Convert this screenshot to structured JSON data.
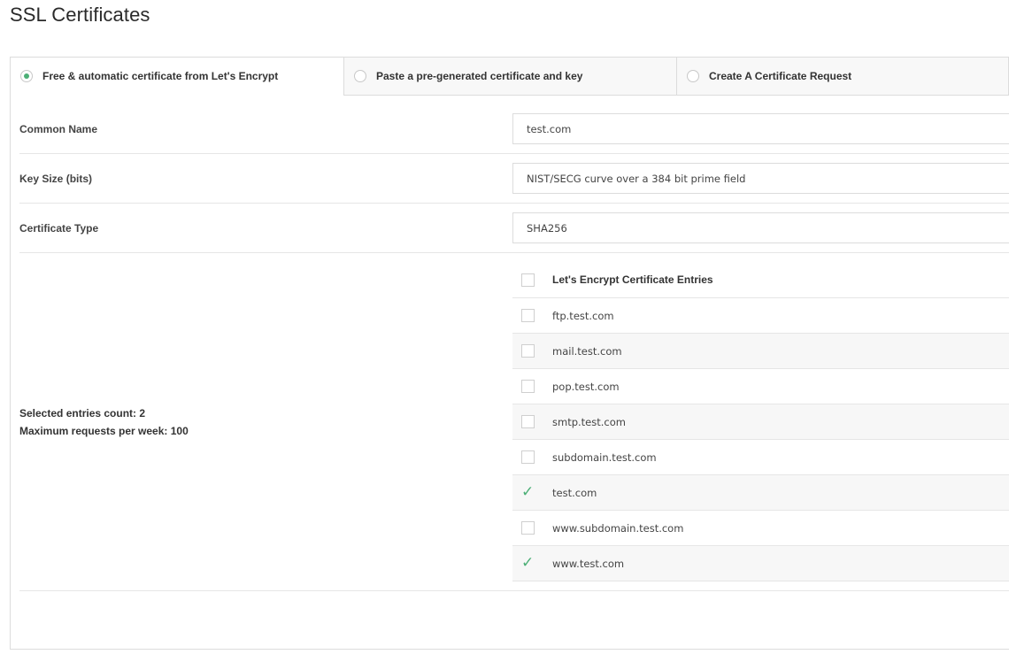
{
  "page": {
    "title": "SSL Certificates"
  },
  "tabs": [
    {
      "label": "Free & automatic certificate from Let's Encrypt",
      "selected": true
    },
    {
      "label": "Paste a pre-generated certificate and key",
      "selected": false
    },
    {
      "label": "Create A Certificate Request",
      "selected": false
    }
  ],
  "form": {
    "common_name": {
      "label": "Common Name",
      "value": "test.com"
    },
    "key_size": {
      "label": "Key Size (bits)",
      "value": "NIST/SECG curve over a 384 bit prime field"
    },
    "certificate_type": {
      "label": "Certificate Type",
      "value": "SHA256"
    }
  },
  "entries": {
    "header": "Let's Encrypt Certificate Entries",
    "items": [
      {
        "name": "ftp.test.com",
        "checked": false
      },
      {
        "name": "mail.test.com",
        "checked": false
      },
      {
        "name": "pop.test.com",
        "checked": false
      },
      {
        "name": "smtp.test.com",
        "checked": false
      },
      {
        "name": "subdomain.test.com",
        "checked": false
      },
      {
        "name": "test.com",
        "checked": true
      },
      {
        "name": "www.subdomain.test.com",
        "checked": false
      },
      {
        "name": "www.test.com",
        "checked": true
      }
    ]
  },
  "summary": {
    "selected_count": "Selected entries count: 2",
    "max_requests": "Maximum requests per week: 100"
  },
  "colors": {
    "accent": "#4caf76",
    "border": "#dcdcdc",
    "shaded_row": "#f7f7f7"
  },
  "icons": {
    "checked": "check-icon",
    "radio_selected": "radio-dot-icon"
  }
}
